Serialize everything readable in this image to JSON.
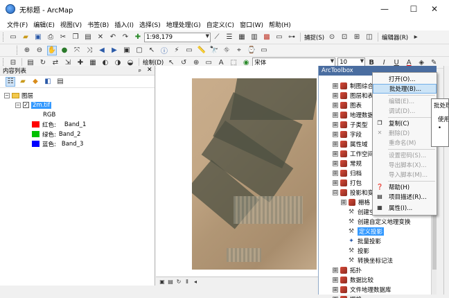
{
  "window": {
    "title": "无标题 - ArcMap",
    "minimize_glyph": "—",
    "maximize_glyph": "☐",
    "close_glyph": "✕"
  },
  "menubar": {
    "items": [
      "文件(F)",
      "编辑(E)",
      "视图(V)",
      "书签(B)",
      "插入(I)",
      "选择(S)",
      "地理处理(G)",
      "自定义(C)",
      "窗口(W)",
      "帮助(H)"
    ]
  },
  "toolbar1": {
    "scale_value": "1:98,179",
    "capture_label": "捕捉(S)",
    "editor_label": "编辑器(R)"
  },
  "toolbar3": {
    "draw_label": "绘制(D)",
    "font_name": "宋体",
    "font_size": "10",
    "bold": "B",
    "italic": "I",
    "underline": "U",
    "text_tool": "A"
  },
  "toc": {
    "title": "内容列表",
    "pin_glyph": "ₚ",
    "close_glyph": "✕",
    "root_label": "图层",
    "layer_label": "2m.tif",
    "rgb_label": "RGB",
    "bands": [
      {
        "label": "红色:",
        "band": "Band_1",
        "color": "#ff0000"
      },
      {
        "label": "绿色:",
        "band": "Band_2",
        "color": "#00c000"
      },
      {
        "label": "蓝色:",
        "band": "Band_3",
        "color": "#0000ff"
      }
    ]
  },
  "toolbox": {
    "title": "ArcToolbox",
    "items": [
      {
        "label": "制图综合",
        "expand": "⊞"
      },
      {
        "label": "图层和表视图",
        "expand": "⊞"
      },
      {
        "label": "图表",
        "expand": "⊞"
      },
      {
        "label": "地理数据库管理",
        "expand": "⊞"
      },
      {
        "label": "子类型",
        "expand": "⊞"
      },
      {
        "label": "字段",
        "expand": "⊞"
      },
      {
        "label": "属性域",
        "expand": "⊞"
      },
      {
        "label": "工作空间",
        "expand": "⊞"
      },
      {
        "label": "常规",
        "expand": "⊞"
      },
      {
        "label": "归档",
        "expand": "⊞"
      },
      {
        "label": "打包",
        "expand": "⊞"
      },
      {
        "label": "投影和变换",
        "expand": "⊟"
      }
    ],
    "subitems": [
      {
        "label": "栅格",
        "expand": "⊞"
      },
      {
        "label": "创建空间参考"
      },
      {
        "label": "创建自定义地理变换"
      },
      {
        "label": "定义投影",
        "selected": true
      },
      {
        "label": "批量投影"
      },
      {
        "label": "投影"
      },
      {
        "label": "转换坐标记法"
      }
    ],
    "after_items": [
      {
        "label": "拓扑",
        "expand": "⊞"
      },
      {
        "label": "数据比较",
        "expand": "⊞"
      },
      {
        "label": "文件地理数据库",
        "expand": "⊞"
      },
      {
        "label": "栅格",
        "expand": "⊞"
      },
      {
        "label": "照片",
        "expand": "⊞"
      }
    ]
  },
  "context_menu": {
    "items": [
      {
        "label": "打开(O)...",
        "disabled": false
      },
      {
        "label": "批处理(B)...",
        "disabled": false,
        "hover": true
      },
      {
        "label": "编辑(E)...",
        "disabled": true
      },
      {
        "label": "调试(D)...",
        "disabled": true
      },
      {
        "label": "复制(C)",
        "disabled": false
      },
      {
        "label": "删除(D)",
        "disabled": true
      },
      {
        "label": "重命名(M)",
        "disabled": true
      },
      {
        "label": "设置密码(S)...",
        "disabled": true
      },
      {
        "label": "导出脚本(X)...",
        "disabled": true
      },
      {
        "label": "导入脚本(M)...",
        "disabled": true
      },
      {
        "label": "帮助(H)",
        "disabled": false
      },
      {
        "label": "项目描述(R)...",
        "disabled": false
      },
      {
        "label": "属性(I)...",
        "disabled": false
      }
    ]
  },
  "tooltip": {
    "title": "批处理",
    "body": "使用",
    "bullet": "•"
  }
}
